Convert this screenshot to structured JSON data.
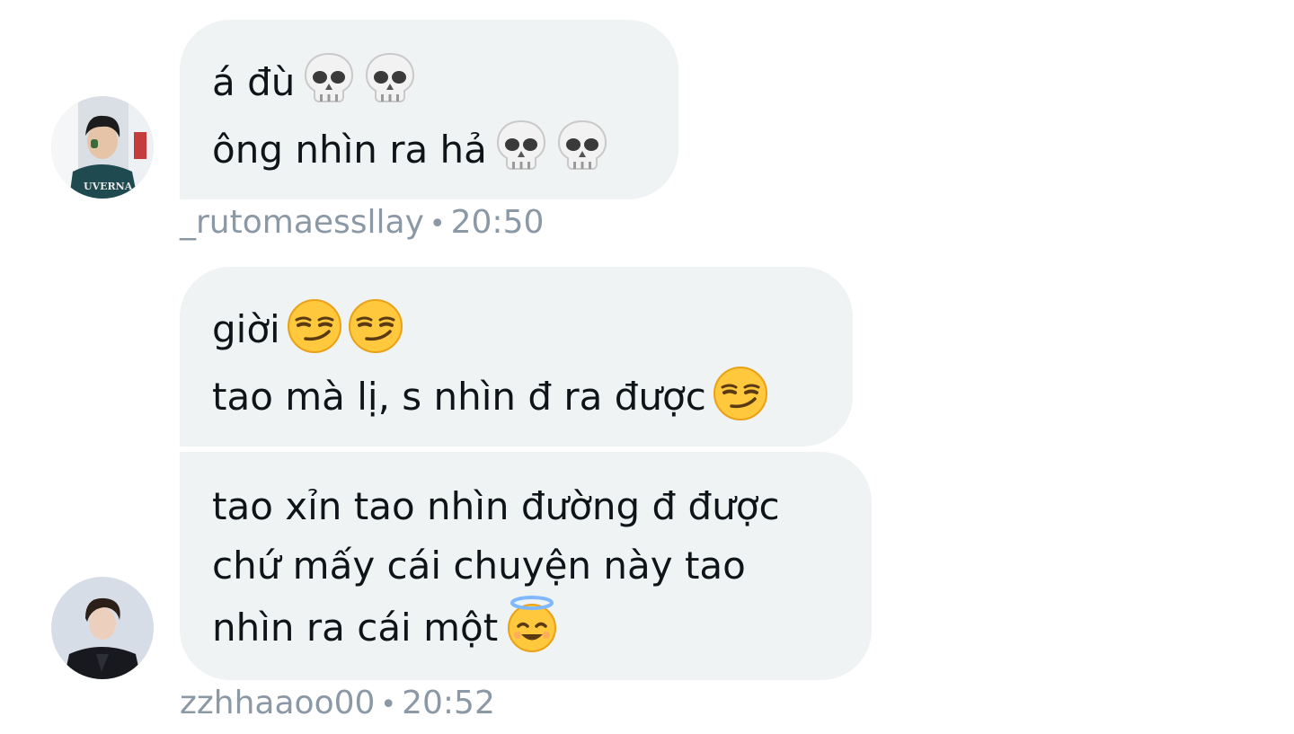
{
  "messages": [
    {
      "lines": [
        "á đù",
        "ông nhìn ra hả"
      ],
      "line_emojis": [
        [
          "skull-icon",
          "skull-icon"
        ],
        [
          "skull-icon",
          "skull-icon"
        ]
      ],
      "username": "_rutomaessllay",
      "separator": "•",
      "time": "20:50"
    },
    {
      "lines": [
        "giời",
        "tao mà lị, s nhìn đ ra được"
      ],
      "line_emojis": [
        [
          "smirk-face-icon",
          "smirk-face-icon"
        ],
        [
          "smirk-face-icon"
        ]
      ]
    },
    {
      "lines": [
        "tao xỉn tao nhìn đường đ được",
        "chứ mấy cái chuyện này tao",
        "nhìn ra cái một"
      ],
      "line_emojis": [
        [],
        [],
        [
          "halo-smile-icon"
        ]
      ],
      "username": "zzhhaaoo00",
      "separator": "•",
      "time": "20:52"
    }
  ],
  "colors": {
    "bubble": "#eff3f4",
    "text": "#0f1419",
    "meta": "#8b98a5"
  }
}
